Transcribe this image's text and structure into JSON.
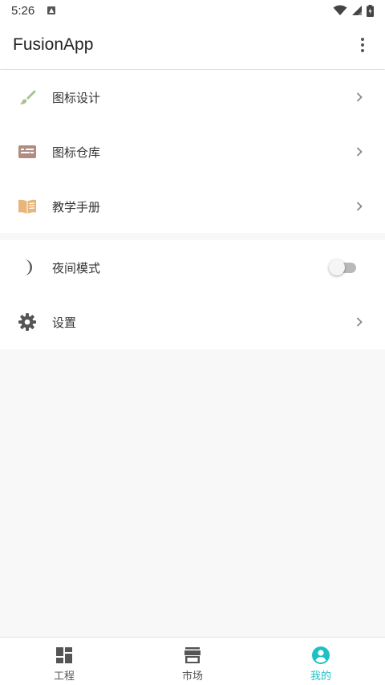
{
  "status_bar": {
    "time": "5:26",
    "icons": [
      "notification-icon",
      "wifi-icon",
      "signal-icon",
      "battery-icon"
    ]
  },
  "app_bar": {
    "title": "FusionApp",
    "menu_icon": "more-vert-icon"
  },
  "menu_group_1": [
    {
      "label": "图标设计",
      "icon": "brush-icon",
      "icon_color": "#a7c18f"
    },
    {
      "label": "图标仓库",
      "icon": "keyboard-icon",
      "icon_color": "#b08c82"
    },
    {
      "label": "教学手册",
      "icon": "book-icon",
      "icon_color": "#e8b57a"
    }
  ],
  "menu_group_2": [
    {
      "label": "夜间模式",
      "icon": "moon-icon",
      "toggle_on": false
    },
    {
      "label": "设置",
      "icon": "gear-icon"
    }
  ],
  "bottom_nav": [
    {
      "label": "工程",
      "icon": "dashboard-icon",
      "active": false
    },
    {
      "label": "市场",
      "icon": "store-icon",
      "active": false
    },
    {
      "label": "我的",
      "icon": "account-icon",
      "active": true
    }
  ],
  "colors": {
    "accent": "#1ec0c3",
    "icon_grey": "#555555",
    "background": "#f8f8f8"
  }
}
